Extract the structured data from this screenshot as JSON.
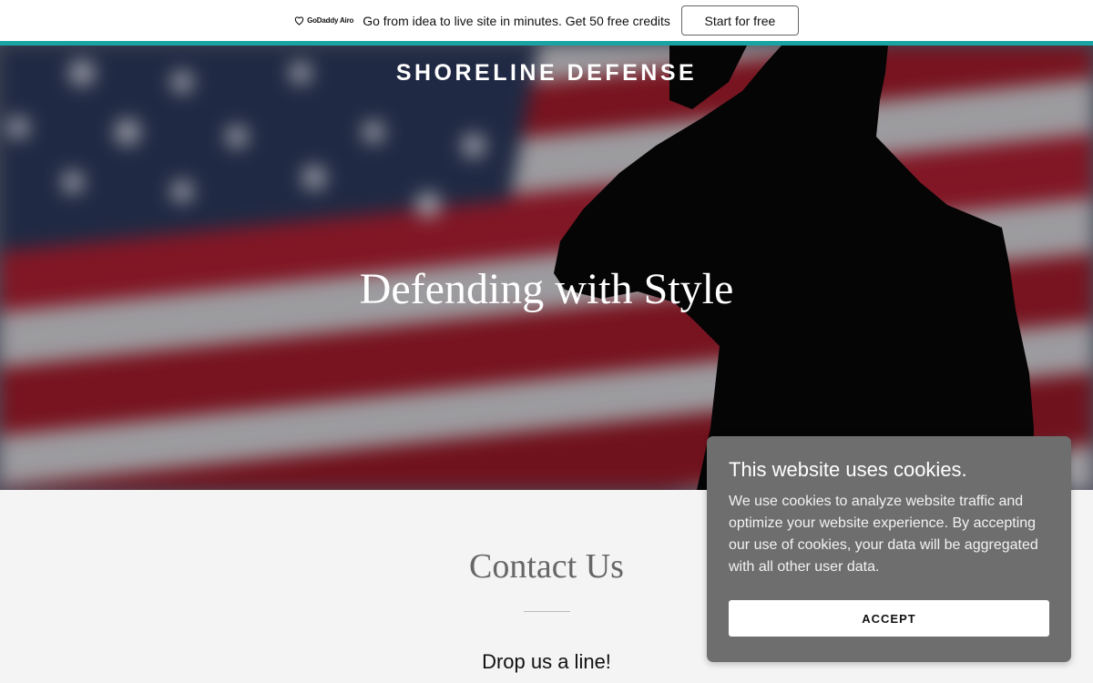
{
  "promo": {
    "logo_text": "GoDaddy Airo",
    "message": "Go from idea to live site in minutes. Get 50 free credits",
    "cta_label": "Start for free"
  },
  "hero": {
    "site_title": "SHORELINE DEFENSE",
    "heading": "Defending with Style"
  },
  "contact": {
    "title": "Contact Us",
    "subtitle": "Drop us a line!"
  },
  "cookie_banner": {
    "title": "This website uses cookies.",
    "body": "We use cookies to analyze website traffic and optimize your website experience. By accepting our use of cookies, your data will be aggregated with all other user data.",
    "accept_label": "ACCEPT"
  },
  "colors": {
    "accent": "#19a3a3",
    "cookie_bg": "#6e6e6e",
    "flag_red": "#b01e2e",
    "flag_blue": "#2c3a5c"
  }
}
